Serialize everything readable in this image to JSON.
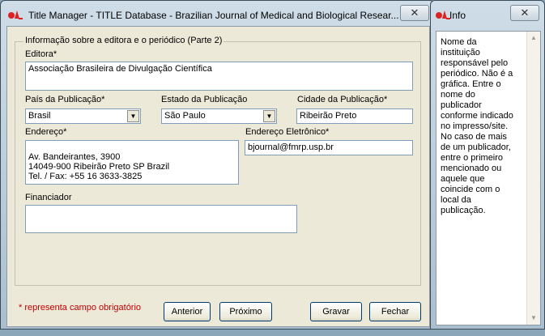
{
  "main_window": {
    "title": "Title Manager - TITLE Database - Brazilian Journal of Medical and Biological Resear...",
    "close_glyph": "✕"
  },
  "form": {
    "group_title": "Informação sobre a editora e o periódico (Parte 2)",
    "editora": {
      "label": "Editora*",
      "value": "Associação Brasileira de Divulgação Científica"
    },
    "pais": {
      "label": "País da Publicação*",
      "value": "Brasil"
    },
    "estado": {
      "label": "Estado da Publicação",
      "value": "São Paulo"
    },
    "cidade": {
      "label": "Cidade da Publicação*",
      "value": "Ribeirão Preto"
    },
    "endereco": {
      "label": "Endereço*",
      "value": "Av. Bandeirantes, 3900\n14049-900 Ribeirão Preto SP Brazil\nTel. / Fax: +55 16 3633-3825"
    },
    "email": {
      "label": "Endereço Eletrônico*",
      "value": "bjournal@fmrp.usp.br"
    },
    "financiador": {
      "label": "Financiador",
      "value": ""
    },
    "required_note": "* representa campo obrigatório"
  },
  "buttons": {
    "anterior": "Anterior",
    "proximo": "Próximo",
    "gravar": "Gravar",
    "fechar": "Fechar"
  },
  "info_window": {
    "title": "Info",
    "close_glyph": "✕",
    "text": "Nome da instituição responsável pelo periódico. Não é a gráfica. Entre o nome do publicador conforme indicado no impresso/site. No caso de mais de um publicador, entre o primeiro mencionado ou aquele que coincide com o local da publicação."
  },
  "colors": {
    "required_text": "#c00000",
    "input_border": "#7f9db9",
    "dialog_bg": "#ece9d8"
  },
  "icons": {
    "app": "scielo-logo-icon",
    "dropdown": "chevron-down-icon",
    "close": "close-icon"
  }
}
